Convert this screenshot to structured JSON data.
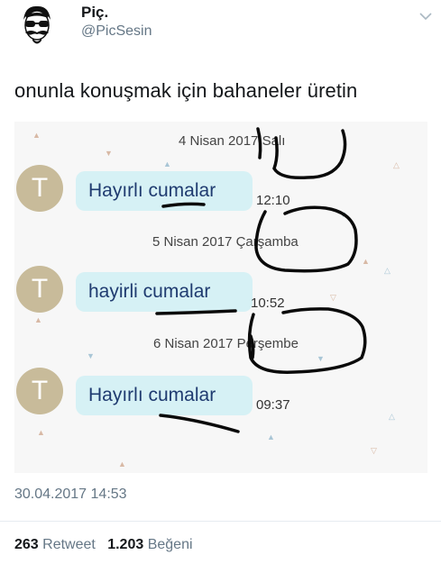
{
  "user": {
    "display_name": "Piç.",
    "handle": "@PicSesin",
    "avatar_icon": "mustache-sunglasses-avatar",
    "menu_icon": "chevron-down-icon"
  },
  "tweet": {
    "text": "onunla konuşmak için bahaneler üretin",
    "timestamp": "30.04.2017 14:53"
  },
  "photo": {
    "messages": [
      {
        "date": "4 Nisan 2017 Salı",
        "avatar_letter": "T",
        "text": "Hayırlı cumalar",
        "time": "12:10"
      },
      {
        "date": "5 Nisan 2017 Çarşamba",
        "avatar_letter": "T",
        "text": "hayirli cumalar",
        "time": "10:52"
      },
      {
        "date": "6 Nisan 2017 Perşembe",
        "avatar_letter": "T",
        "text": "Hayırlı cumalar",
        "time": "09:37"
      }
    ],
    "colors": {
      "bubble": "#d6f1f5",
      "avatar": "#c8bb9a",
      "bubble_text": "#1f3b70"
    }
  },
  "stats": {
    "retweet_count": "263",
    "retweet_label": "Retweet",
    "like_count": "1.203",
    "like_label": "Beğeni"
  }
}
